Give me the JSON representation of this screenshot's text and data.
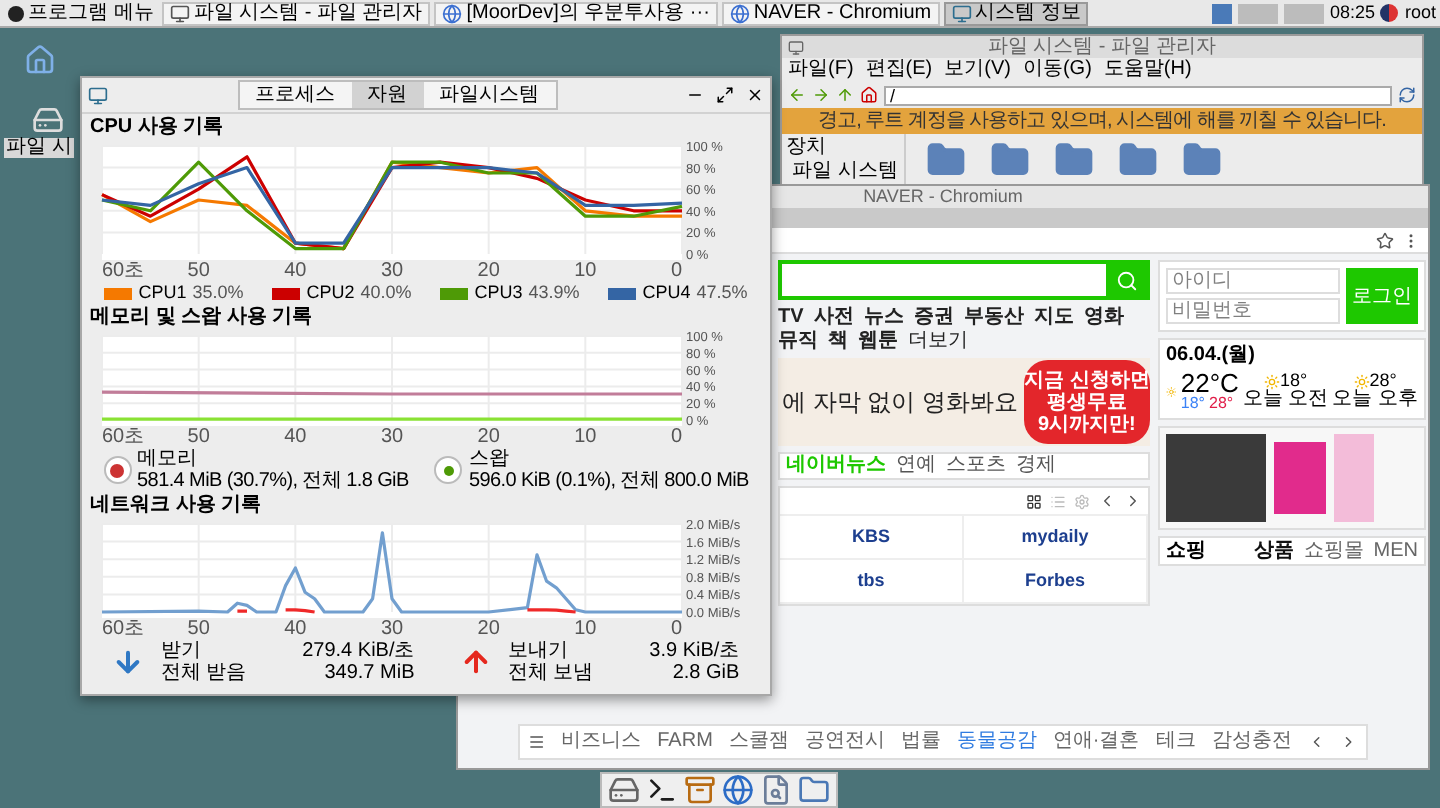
{
  "taskbar": {
    "menu_label": "프로그램 메뉴",
    "tasks": [
      {
        "label": "파일 시스템 - 파일 관리자",
        "kind": "files",
        "selected": false
      },
      {
        "label": "[MoorDev]의 우분투사용 ···",
        "kind": "web",
        "selected": false
      },
      {
        "label": "NAVER - Chromium",
        "kind": "web",
        "selected": false
      },
      {
        "label": "시스템 정보",
        "kind": "monitor",
        "selected": true
      }
    ],
    "clock": "08:25",
    "user": "root"
  },
  "desktop_icons": [
    {
      "kind": "home"
    },
    {
      "kind": "drive",
      "label": "파일 시"
    }
  ],
  "file_manager": {
    "title": "파일 시스템 - 파일 관리자",
    "menu": [
      "파일(F)",
      "편집(E)",
      "보기(V)",
      "이동(G)",
      "도움말(H)"
    ],
    "path": "/",
    "warning": "경고, 루트 계정을 사용하고 있으며, 시스템에 해를 끼칠 수 있습니다.",
    "sidebar": [
      {
        "kind": "heading",
        "label": "장치"
      },
      {
        "kind": "item",
        "label": "파일 시스템"
      }
    ]
  },
  "browser": {
    "title": "NAVER - Chromium",
    "nav_links": [
      "TV",
      "사전",
      "뉴스",
      "증권",
      "부동산",
      "지도",
      "영화",
      "뮤직",
      "책",
      "웹툰"
    ],
    "more": "더보기",
    "banner": {
      "headline": "에 자막 없이 영화봐요",
      "badge_lines": [
        "지금 신청하면",
        "평생무료",
        "9시까지만!"
      ]
    },
    "login": {
      "id_placeholder": "아이디",
      "pw_placeholder": "비밀번호",
      "button": "로그인"
    },
    "news_tabs": [
      {
        "label": "네이버뉴스",
        "selected": true
      },
      {
        "label": "연예",
        "selected": false
      },
      {
        "label": "스포츠",
        "selected": false
      },
      {
        "label": "경제",
        "selected": false
      }
    ],
    "press": [
      "KBS",
      "mydaily",
      "tbs",
      "Forbes"
    ],
    "weather": {
      "date": "06.04.(월)",
      "temp": "22°C",
      "low": "18°",
      "high": "28°",
      "forecast": [
        {
          "temp": "18°",
          "label": "오늘 오전"
        },
        {
          "temp": "28°",
          "label": "오늘 오후"
        }
      ]
    },
    "shopping": {
      "title": "쇼핑",
      "tabs": [
        {
          "label": "상품",
          "selected": true
        },
        {
          "label": "쇼핑몰",
          "selected": false
        },
        {
          "label": "MEN",
          "selected": false
        }
      ]
    },
    "bottom_nav": [
      {
        "label": "비즈니스",
        "selected": false
      },
      {
        "label": "FARM",
        "selected": false
      },
      {
        "label": "스쿨잼",
        "selected": false
      },
      {
        "label": "공연전시",
        "selected": false
      },
      {
        "label": "법률",
        "selected": false
      },
      {
        "label": "동물공감",
        "selected": true
      },
      {
        "label": "연애·결혼",
        "selected": false
      },
      {
        "label": "테크",
        "selected": false
      },
      {
        "label": "감성충전",
        "selected": false
      }
    ]
  },
  "monitor": {
    "tabs": [
      {
        "label": "프로세스",
        "selected": false
      },
      {
        "label": "자원",
        "selected": true
      },
      {
        "label": "파일시스템",
        "selected": false
      }
    ],
    "cpu": {
      "title": "CPU 사용 기록",
      "readings": [
        "35.0%",
        "40.0%",
        "43.9%",
        "47.5%"
      ],
      "chart_data": {
        "type": "line",
        "grid": true,
        "xlim": [
          60,
          0
        ],
        "ylim": [
          0,
          100
        ],
        "x": [
          60,
          55,
          50,
          45,
          40,
          35,
          30,
          25,
          20,
          15,
          10,
          5,
          0
        ],
        "xticks": [
          {
            "value": 60,
            "label": "60초"
          },
          50,
          40,
          30,
          20,
          10,
          0
        ],
        "yticks": [
          {
            "value": 0,
            "label": "0 %"
          },
          {
            "value": 20,
            "label": "20 %"
          },
          {
            "value": 40,
            "label": "40 %"
          },
          {
            "value": 60,
            "label": "60 %"
          },
          {
            "value": 80,
            "label": "80 %"
          },
          {
            "value": 100,
            "label": "100 %"
          }
        ],
        "series": [
          {
            "name": "CPU1",
            "color": "#f57900",
            "values": [
              55,
              30,
              50,
              45,
              10,
              5,
              85,
              80,
              75,
              80,
              40,
              35,
              35
            ]
          },
          {
            "name": "CPU2",
            "color": "#cc0000",
            "values": [
              55,
              35,
              60,
              90,
              10,
              5,
              80,
              85,
              80,
              70,
              50,
              40,
              40
            ]
          },
          {
            "name": "CPU3",
            "color": "#4e9a06",
            "values": [
              50,
              40,
              85,
              40,
              5,
              5,
              85,
              85,
              75,
              75,
              35,
              35,
              44
            ]
          },
          {
            "name": "CPU4",
            "color": "#3465a4",
            "values": [
              50,
              45,
              65,
              80,
              10,
              10,
              80,
              80,
              80,
              75,
              45,
              45,
              47
            ]
          }
        ]
      }
    },
    "memory": {
      "title": "메모리 및 스왑 사용 기록",
      "legend": [
        {
          "kind": "memory",
          "detail": "581.4 MiB (30.7%), 전체 1.8 GiB"
        },
        {
          "kind": "swap",
          "detail": "596.0 KiB (0.1%), 전체 800.0 MiB"
        }
      ],
      "chart_data": {
        "type": "line",
        "grid": true,
        "xlim": [
          60,
          0
        ],
        "ylim": [
          0,
          100
        ],
        "x": [
          60,
          30,
          0
        ],
        "xticks": [
          {
            "value": 60,
            "label": "60초"
          },
          50,
          40,
          30,
          20,
          10,
          0
        ],
        "yticks": [
          {
            "value": 0,
            "label": "0 %"
          },
          {
            "value": 20,
            "label": "20 %"
          },
          {
            "value": 40,
            "label": "40 %"
          },
          {
            "value": 60,
            "label": "60 %"
          },
          {
            "value": 80,
            "label": "80 %"
          },
          {
            "value": 100,
            "label": "100 %"
          }
        ],
        "series": [
          {
            "name": "메모리",
            "color": "#c17d99",
            "values": [
              33,
              31,
              31
            ]
          },
          {
            "name": "스왑",
            "color": "#8ae234",
            "values": [
              1,
              1,
              1
            ]
          }
        ]
      }
    },
    "network": {
      "title": "네트워크 사용 기록",
      "legend": [
        {
          "kind": "received",
          "rate": "279.4 KiB/초",
          "total_label": "전체 받음",
          "total": "349.7 MiB"
        },
        {
          "kind": "sent",
          "rate": "3.9 KiB/초",
          "total_label": "전체 보냄",
          "total": "2.8 GiB"
        }
      ],
      "chart_data": {
        "type": "line",
        "grid": true,
        "xlim": [
          60,
          0
        ],
        "ylim": [
          0,
          2
        ],
        "x": [
          60,
          50,
          47,
          46,
          45,
          44,
          42,
          41,
          40,
          39,
          38,
          37,
          33,
          32,
          31,
          30,
          29,
          20,
          16,
          15,
          14,
          13,
          12,
          11,
          10,
          0
        ],
        "xticks": [
          {
            "value": 60,
            "label": "60초"
          },
          50,
          40,
          30,
          20,
          10,
          0
        ],
        "yticks": [
          {
            "value": 0,
            "label": "0.0 MiB/s"
          },
          {
            "value": 0.4,
            "label": "0.4 MiB/s"
          },
          {
            "value": 0.8,
            "label": "0.8 MiB/s"
          },
          {
            "value": 1.2,
            "label": "1.2 MiB/s"
          },
          {
            "value": 1.6,
            "label": "1.6 MiB/s"
          },
          {
            "value": 2,
            "label": "2.0 MiB/s"
          }
        ],
        "series": [
          {
            "name": "받기",
            "color": "#729fcf",
            "values": [
              0,
              0.02,
              0,
              0.2,
              0.15,
              0,
              0,
              0.6,
              1.0,
              0.45,
              0.3,
              0,
              0,
              0.3,
              1.8,
              0.3,
              0,
              0,
              0.1,
              1.3,
              0.7,
              0.55,
              0.3,
              0.05,
              0,
              0
            ]
          },
          {
            "name": "보내기",
            "color": "#ef2929",
            "values": [
              null,
              null,
              null,
              0.02,
              0.02,
              null,
              null,
              0.05,
              0.05,
              0.03,
              0,
              null,
              null,
              null,
              null,
              null,
              null,
              null,
              0.05,
              0.05,
              0.05,
              0.04,
              0.02,
              0,
              null,
              null
            ]
          }
        ]
      }
    }
  },
  "dock": [
    {
      "kind": "drive"
    },
    {
      "kind": "terminal"
    },
    {
      "kind": "archive"
    },
    {
      "kind": "globe"
    },
    {
      "kind": "viewer"
    },
    {
      "kind": "folder"
    }
  ]
}
